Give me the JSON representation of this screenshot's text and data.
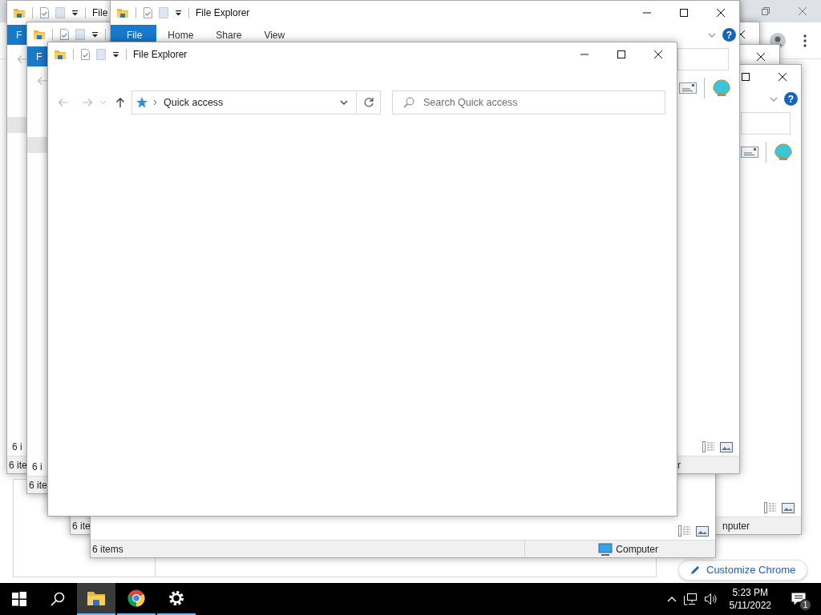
{
  "browser": {
    "customize_button": "Customize Chrome"
  },
  "windows": [
    {
      "kind": "explorer",
      "title": "File",
      "ribbon_tabs": [
        {
          "label": "F",
          "selected": true
        }
      ],
      "item_count": "6 i",
      "status_text": "6 ite"
    },
    {
      "kind": "explorer",
      "ribbon_tabs": [
        {
          "label": "F",
          "selected": true
        }
      ],
      "item_count": "6 i",
      "status_text": "6 ite"
    },
    {
      "kind": "explorer"
    },
    {
      "kind": "explorer",
      "help_button": "?",
      "status_text": "6 ite",
      "status_location": "nputer"
    },
    {
      "kind": "explorer",
      "status_text": "6 items",
      "status_location": "Computer"
    },
    {
      "kind": "explorer",
      "title": "File Explorer",
      "ribbon_tabs": [
        {
          "label": "File",
          "selected": true
        },
        {
          "label": "Home",
          "selected": false
        },
        {
          "label": "Share",
          "selected": false
        },
        {
          "label": "View",
          "selected": false
        }
      ],
      "help_button": "?",
      "status_location": "r"
    },
    {
      "kind": "explorer",
      "title": "File Explorer",
      "address": "Quick access",
      "search_placeholder": "Search Quick access"
    }
  ],
  "taskbar": {
    "apps": [
      {
        "kind": "explorer",
        "selected": true
      },
      {
        "kind": "chrome",
        "selected": false
      },
      {
        "kind": "settings",
        "selected": false
      }
    ],
    "time": "5:23 PM",
    "date": "5/11/2022",
    "notification_count": "1"
  }
}
